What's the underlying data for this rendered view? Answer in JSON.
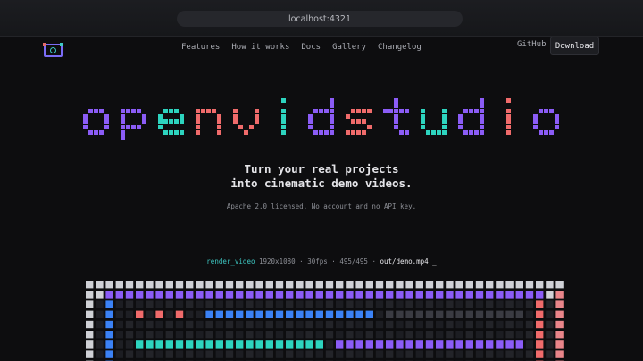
{
  "browser": {
    "url": "localhost:4321"
  },
  "nav": {
    "items": [
      "Features",
      "How it works",
      "Docs",
      "Gallery",
      "Changelog"
    ],
    "github": "GitHub",
    "download": "Download"
  },
  "hero": {
    "wordmark": "openvidstudio",
    "tagline_line1": "Turn your real projects",
    "tagline_line2": "into cinematic demo videos.",
    "license": "Apache 2.0 licensed. No account and no API key.",
    "render": {
      "command": "render_video",
      "resolution": "1920x1080",
      "fps": "30fps",
      "frames": "495/495",
      "output": "out/demo.mp4 _",
      "separator": "·"
    }
  },
  "colors": {
    "purple": "#8b5cf6",
    "teal": "#2dd4bf",
    "red": "#f06b6b",
    "blue": "#3b82f6",
    "gray": "#cfd1d6"
  },
  "icons": {
    "logo": "pixel-camera-logo-icon"
  }
}
